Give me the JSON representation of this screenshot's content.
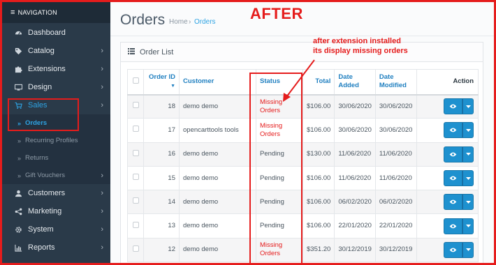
{
  "sidebar": {
    "heading": "NAVIGATION",
    "menu_icon": "hamburger-icon",
    "items": [
      {
        "label": "Dashboard",
        "icon": "dashboard-icon",
        "has_chevron": false
      },
      {
        "label": "Catalog",
        "icon": "tag-icon",
        "has_chevron": true
      },
      {
        "label": "Extensions",
        "icon": "puzzle-icon",
        "has_chevron": true
      },
      {
        "label": "Design",
        "icon": "monitor-icon",
        "has_chevron": true
      },
      {
        "label": "Sales",
        "icon": "cart-icon",
        "has_chevron": true,
        "active": true
      },
      {
        "label": "Customers",
        "icon": "user-icon",
        "has_chevron": true
      },
      {
        "label": "Marketing",
        "icon": "share-icon",
        "has_chevron": true
      },
      {
        "label": "System",
        "icon": "gear-icon",
        "has_chevron": true
      },
      {
        "label": "Reports",
        "icon": "bar-chart-icon",
        "has_chevron": true
      }
    ],
    "sales_submenu": [
      {
        "label": "Orders",
        "active": true
      },
      {
        "label": "Recurring Profiles"
      },
      {
        "label": "Returns"
      },
      {
        "label": "Gift Vouchers",
        "has_chevron": true
      }
    ]
  },
  "header": {
    "title": "Orders",
    "breadcrumb": [
      "Home",
      "Orders"
    ],
    "breadcrumb_separator": "›"
  },
  "overlay": {
    "banner": "AFTER",
    "annotation_line1": "after extension installed",
    "annotation_line2": "its display missing orders",
    "highlight_color": "#e51c1c"
  },
  "panel": {
    "title": "Order List",
    "icon": "list-icon"
  },
  "table": {
    "columns": [
      "Order ID",
      "Customer",
      "Status",
      "Total",
      "Date Added",
      "Date Modified",
      "Action"
    ],
    "sort_arrow": "▼",
    "rows": [
      {
        "id": "18",
        "customer": "demo demo",
        "status": "Missing Orders",
        "total": "$106.00",
        "added": "30/06/2020",
        "modified": "30/06/2020"
      },
      {
        "id": "17",
        "customer": "opencarttools tools",
        "status": "Missing Orders",
        "total": "$106.00",
        "added": "30/06/2020",
        "modified": "30/06/2020"
      },
      {
        "id": "16",
        "customer": "demo demo",
        "status": "Pending",
        "total": "$130.00",
        "added": "11/06/2020",
        "modified": "11/06/2020"
      },
      {
        "id": "15",
        "customer": "demo demo",
        "status": "Pending",
        "total": "$106.00",
        "added": "11/06/2020",
        "modified": "11/06/2020"
      },
      {
        "id": "14",
        "customer": "demo demo",
        "status": "Pending",
        "total": "$106.00",
        "added": "06/02/2020",
        "modified": "06/02/2020"
      },
      {
        "id": "13",
        "customer": "demo demo",
        "status": "Pending",
        "total": "$106.00",
        "added": "22/01/2020",
        "modified": "22/01/2020"
      },
      {
        "id": "12",
        "customer": "demo demo",
        "status": "Missing Orders",
        "total": "$351.20",
        "added": "30/12/2019",
        "modified": "30/12/2019"
      }
    ],
    "action_icon": "eye-icon",
    "dropdown_icon": "caret-down-icon",
    "accent_color": "#1e91cf"
  }
}
